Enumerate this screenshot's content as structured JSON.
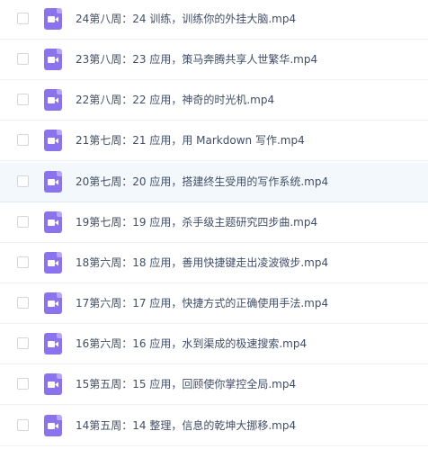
{
  "file_list": {
    "files": [
      {
        "name": "24第八周：24 训练，训练你的外挂大脑.mp4",
        "icon": "video-file-icon"
      },
      {
        "name": "23第八周：23 应用，策马奔腾共享人世繁华.mp4",
        "icon": "video-file-icon"
      },
      {
        "name": "22第八周：22 应用，神奇的时光机.mp4",
        "icon": "video-file-icon"
      },
      {
        "name": "21第七周：21 应用，用 Markdown 写作.mp4",
        "icon": "video-file-icon"
      },
      {
        "name": "20第七周：20 应用，搭建终生受用的写作系统.mp4",
        "icon": "video-file-icon"
      },
      {
        "name": "19第七周：19 应用，杀手级主题研究四步曲.mp4",
        "icon": "video-file-icon"
      },
      {
        "name": "18第六周：18 应用，善用快捷键走出凌波微步.mp4",
        "icon": "video-file-icon"
      },
      {
        "name": "17第六周：17 应用，快捷方式的正确使用手法.mp4",
        "icon": "video-file-icon"
      },
      {
        "name": "16第六周：16 应用，水到渠成的极速搜索.mp4",
        "icon": "video-file-icon"
      },
      {
        "name": "15第五周：15 应用，回顾使你掌控全局.mp4",
        "icon": "video-file-icon"
      },
      {
        "name": "14第五周：14 整理，信息的乾坤大挪移.mp4",
        "icon": "video-file-icon"
      }
    ]
  },
  "colors": {
    "icon_purple": "#8c73ee",
    "hover_row": "#f3f8fd",
    "text": "#424e67"
  }
}
